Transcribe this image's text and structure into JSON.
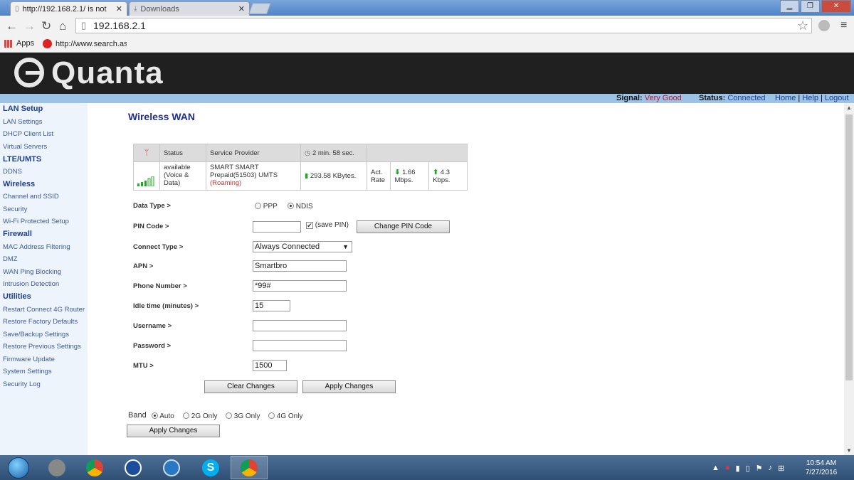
{
  "browser": {
    "tabs": [
      {
        "title": "http://192.168.2.1/ is not"
      },
      {
        "title": "Downloads"
      }
    ],
    "address": "192.168.2.1",
    "bookmarks": [
      {
        "label": "Apps"
      },
      {
        "label": "http://www.search.ask"
      }
    ]
  },
  "router": {
    "brand": "Quanta",
    "signal_label": "Signal:",
    "signal_value": "Very Good",
    "status_label": "Status:",
    "status_value": "Connected",
    "links": [
      "Home",
      "Help",
      "Logout"
    ]
  },
  "sidebar": [
    {
      "section": "LAN Setup",
      "items": [
        "LAN Settings",
        "DHCP Client List",
        "Virtual Servers"
      ]
    },
    {
      "section": "LTE/UMTS",
      "items": [
        "DDNS"
      ]
    },
    {
      "section": "Wireless",
      "items": [
        "Channel and SSID",
        "Security",
        "Wi-Fi Protected Setup"
      ]
    },
    {
      "section": "Firewall",
      "items": [
        "MAC Address Filtering",
        "DMZ",
        "WAN Ping Blocking",
        "Intrusion Detection"
      ]
    },
    {
      "section": "Utilities",
      "items": [
        "Restart Connect 4G Router",
        "Restore Factory Defaults",
        "Save/Backup Settings",
        "Restore Previous Settings",
        "Firmware Update",
        "System Settings",
        "Security Log"
      ]
    }
  ],
  "page": {
    "title": "Wireless WAN",
    "table": {
      "headers": {
        "status": "Status",
        "provider": "Service Provider",
        "time": "2 min. 58 sec."
      },
      "status": "available (Voice & Data)",
      "provider": "SMART SMART Prepaid(51503) UMTS",
      "roaming": "(Roaming)",
      "bytes": "293.58 KBytes.",
      "act_rate_label": "Act. Rate",
      "down_rate": "1.66 Mbps.",
      "up_rate": "4.3 Kbps.",
      "signal_bars": 5
    },
    "form": {
      "data_type": {
        "label": "Data Type >",
        "options": [
          "PPP",
          "NDIS"
        ],
        "selected": "NDIS"
      },
      "pin_code": {
        "label": "PIN Code >",
        "value": "",
        "save_pin_label": "(save PIN)",
        "save_pin_checked": true,
        "change_button": "Change PIN Code"
      },
      "connect_type": {
        "label": "Connect Type >",
        "value": "Always Connected"
      },
      "apn": {
        "label": "APN >",
        "value": "Smartbro"
      },
      "phone_number": {
        "label": "Phone Number >",
        "value": "*99#"
      },
      "idle_time": {
        "label": "Idle time (minutes) >",
        "value": "15"
      },
      "username": {
        "label": "Username >",
        "value": ""
      },
      "password": {
        "label": "Password >",
        "value": ""
      },
      "mtu": {
        "label": "MTU >",
        "value": "1500"
      },
      "clear_button": "Clear Changes",
      "apply_button": "Apply Changes"
    },
    "band": {
      "label": "Band",
      "options": [
        "Auto",
        "2G Only",
        "3G Only",
        "4G Only"
      ],
      "selected": "Auto",
      "apply_button": "Apply Changes"
    }
  },
  "taskbar": {
    "time": "10:54 AM",
    "date": "7/27/2016"
  }
}
